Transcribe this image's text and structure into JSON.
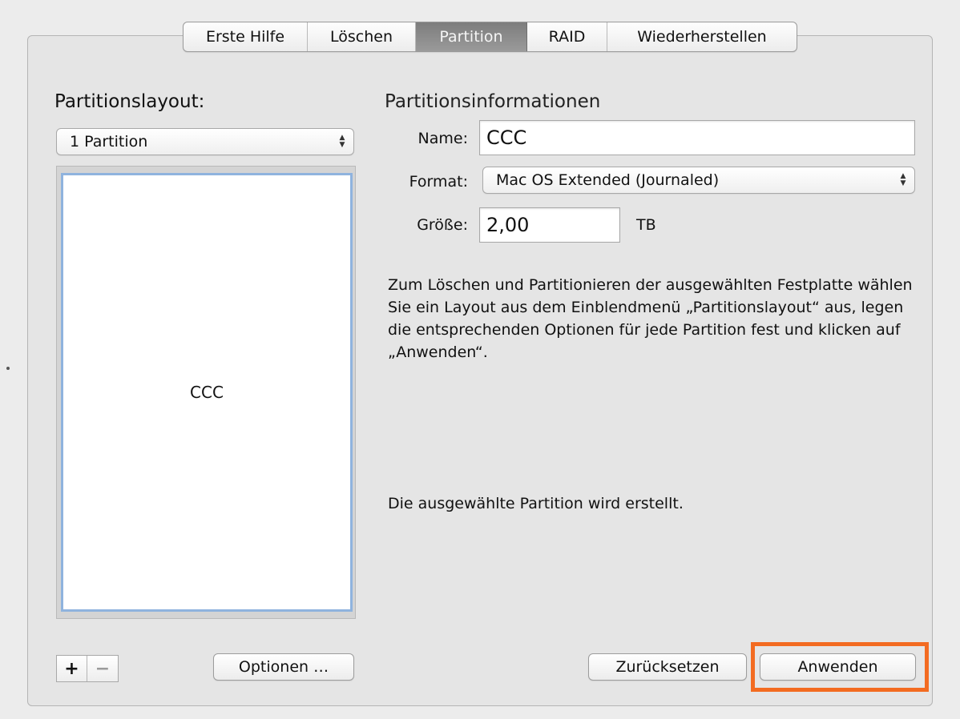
{
  "tabs": [
    {
      "label": "Erste Hilfe"
    },
    {
      "label": "Löschen"
    },
    {
      "label": "Partition"
    },
    {
      "label": "RAID"
    },
    {
      "label": "Wiederherstellen"
    }
  ],
  "active_tab": "Partition",
  "left": {
    "heading": "Partitionslayout:",
    "layout_select": "1 Partition",
    "partition_label": "CCC",
    "add_icon": "plus-icon",
    "remove_icon": "minus-icon",
    "options_button": "Optionen …"
  },
  "right": {
    "heading": "Partitionsinformationen",
    "name_label": "Name:",
    "name_value": "CCC",
    "format_label": "Format:",
    "format_value": "Mac OS Extended (Journaled)",
    "size_label": "Größe:",
    "size_value": "2,00",
    "size_unit": "TB",
    "description": "Zum Löschen und Partitionieren der ausgewählten Festplatte wählen Sie ein Layout aus dem Einblendmenü „Partitionslayout“ aus, legen die entsprechenden Optionen für jede Partition fest und klicken auf „Anwenden“.",
    "status": "Die ausgewählte Partition wird erstellt."
  },
  "buttons": {
    "reset": "Zurücksetzen",
    "apply": "Anwenden"
  },
  "colors": {
    "highlight": "#f36b21",
    "selection_border": "#8fb3de"
  }
}
